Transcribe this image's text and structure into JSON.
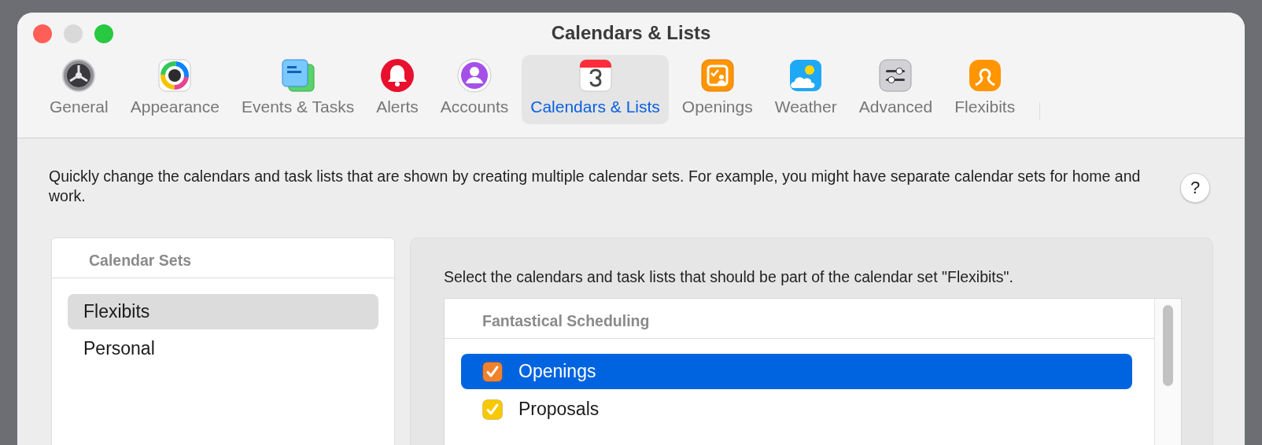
{
  "window": {
    "title": "Calendars & Lists"
  },
  "tabs": [
    {
      "label": "General",
      "selected": false
    },
    {
      "label": "Appearance",
      "selected": false
    },
    {
      "label": "Events & Tasks",
      "selected": false
    },
    {
      "label": "Alerts",
      "selected": false
    },
    {
      "label": "Accounts",
      "selected": false
    },
    {
      "label": "Calendars & Lists",
      "selected": true
    },
    {
      "label": "Openings",
      "selected": false
    },
    {
      "label": "Weather",
      "selected": false
    },
    {
      "label": "Advanced",
      "selected": false
    },
    {
      "label": "Flexibits",
      "selected": false
    }
  ],
  "description": "Quickly change the calendars and task lists that are shown by creating multiple calendar sets. For example, you might have separate calendar sets for home and work.",
  "help_button": "?",
  "calendar_sets": {
    "header": "Calendar Sets",
    "items": [
      {
        "label": "Flexibits",
        "selected": true
      },
      {
        "label": "Personal",
        "selected": false
      }
    ]
  },
  "detail": {
    "instruction": "Select the calendars and task lists that should be part of the calendar set \"Flexibits\".",
    "groups": [
      {
        "header": "Fantastical Scheduling",
        "items": [
          {
            "label": "Openings",
            "checked": true,
            "selected": true,
            "color": "#f0822e"
          },
          {
            "label": "Proposals",
            "checked": true,
            "selected": false,
            "color": "#f8c800"
          }
        ]
      }
    ]
  }
}
